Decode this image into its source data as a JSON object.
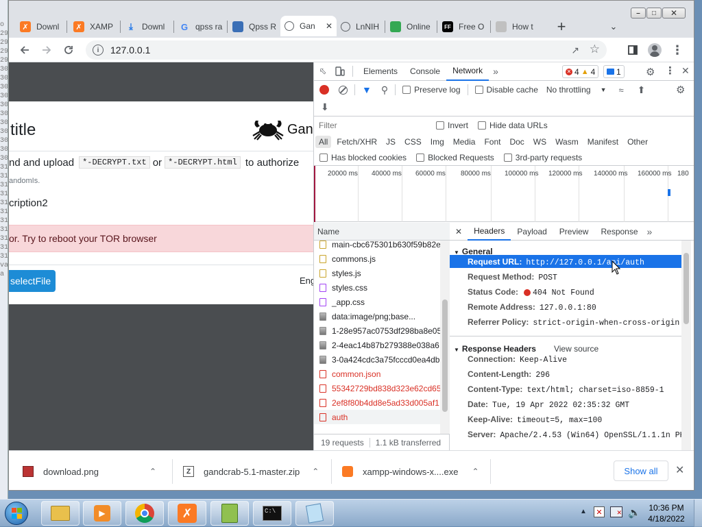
{
  "left_strip_chars": [
    "o",
    "29",
    "29",
    "29",
    "29",
    "30",
    "30",
    "30",
    "30",
    "30",
    "30",
    "30",
    "30",
    "30",
    "30",
    "30",
    "31",
    "31",
    "31",
    "31",
    "31",
    "31",
    "31",
    "31",
    "31",
    "31",
    "31",
    "va",
    "a"
  ],
  "tabs": [
    {
      "title": "Downl",
      "icon": "xampp-icon",
      "color": "#fb7a24"
    },
    {
      "title": "XAMP",
      "icon": "xampp-icon",
      "color": "#fb7a24"
    },
    {
      "title": "Downl",
      "icon": "download-icon",
      "color": "#1a73e8"
    },
    {
      "title": "qpss ra",
      "icon": "google-icon",
      "color": "#4285f4"
    },
    {
      "title": "Qpss R",
      "icon": "qpss-icon",
      "color": "#3b6fb6"
    },
    {
      "title": "Gan",
      "icon": "globe-icon",
      "color": "#5f6368"
    },
    {
      "title": "LnNIH",
      "icon": "globe-icon",
      "color": "#5f6368"
    },
    {
      "title": "Online",
      "icon": "online-icon",
      "color": "#34a853"
    },
    {
      "title": "Free O",
      "icon": "ff-icon",
      "color": "#000000"
    },
    {
      "title": "How t",
      "icon": "face-icon",
      "color": "#c0c0c0"
    }
  ],
  "address": "127.0.0.1",
  "page": {
    "title": "title",
    "brand": "Gan",
    "upload_text_pre": "nd and upload",
    "code1": "*-DECRYPT.txt",
    "or": "or",
    "code2": "*-DECRYPT.html",
    "upload_text_post": "to authorize",
    "random_ids": "andomIs.",
    "description": "cription2",
    "error": "or. Try to reboot your TOR browser",
    "select_button": "selectFile",
    "lang": "Eng"
  },
  "devtools": {
    "tabs": [
      "Elements",
      "Console",
      "Network"
    ],
    "active_tab": "Network",
    "errors": "4",
    "warnings": "4",
    "messages": "1",
    "preserve_log": "Preserve log",
    "disable_cache": "Disable cache",
    "throttling": "No throttling",
    "filter_placeholder": "Filter",
    "invert": "Invert",
    "hide_data_urls": "Hide data URLs",
    "types": [
      "All",
      "Fetch/XHR",
      "JS",
      "CSS",
      "Img",
      "Media",
      "Font",
      "Doc",
      "WS",
      "Wasm",
      "Manifest",
      "Other"
    ],
    "blocked_cookies": "Has blocked cookies",
    "blocked_requests": "Blocked Requests",
    "third_party": "3rd-party requests",
    "timeline_ticks": [
      "20000 ms",
      "40000 ms",
      "60000 ms",
      "80000 ms",
      "100000 ms",
      "120000 ms",
      "140000 ms",
      "160000 ms",
      "180"
    ],
    "name_header": "Name",
    "requests": [
      {
        "name": "main-cbc675301b630f59b82e",
        "kind": "js",
        "color": "#202124"
      },
      {
        "name": "commons.js",
        "kind": "js",
        "color": "#202124"
      },
      {
        "name": "styles.js",
        "kind": "js",
        "color": "#202124"
      },
      {
        "name": "styles.css",
        "kind": "css",
        "color": "#202124"
      },
      {
        "name": "_app.css",
        "kind": "css",
        "color": "#202124"
      },
      {
        "name": "data:image/png;base...",
        "kind": "img",
        "color": "#202124"
      },
      {
        "name": "1-28e957ac0753df298ba8e05",
        "kind": "img",
        "color": "#202124"
      },
      {
        "name": "2-4eac14b87b279388e038a6",
        "kind": "img",
        "color": "#202124"
      },
      {
        "name": "3-0a424cdc3a75fcccd0ea4db",
        "kind": "img",
        "color": "#202124"
      },
      {
        "name": "common.json",
        "kind": "err",
        "color": "#d93025"
      },
      {
        "name": "55342729bd838d323e62cd65",
        "kind": "err",
        "color": "#d93025"
      },
      {
        "name": "2ef8f80b4dd8e5ad33d005af1",
        "kind": "err",
        "color": "#d93025"
      },
      {
        "name": "auth",
        "kind": "err",
        "color": "#d93025"
      }
    ],
    "summary_requests": "19 requests",
    "summary_transferred": "1.1 kB transferred",
    "detail_tabs": [
      "Headers",
      "Payload",
      "Preview",
      "Response"
    ],
    "general_label": "General",
    "general": [
      {
        "key": "Request URL:",
        "value": "http://127.0.0.1/api/auth"
      },
      {
        "key": "Request Method:",
        "value": "POST"
      },
      {
        "key": "Status Code:",
        "value": "404 Not Found"
      },
      {
        "key": "Remote Address:",
        "value": "127.0.0.1:80"
      },
      {
        "key": "Referrer Policy:",
        "value": "strict-origin-when-cross-origin"
      }
    ],
    "response_headers_label": "Response Headers",
    "view_source": "View source",
    "response_headers": [
      {
        "key": "Connection:",
        "value": "Keep-Alive"
      },
      {
        "key": "Content-Length:",
        "value": "296"
      },
      {
        "key": "Content-Type:",
        "value": "text/html; charset=iso-8859-1"
      },
      {
        "key": "Date:",
        "value": "Tue, 19 Apr 2022 02:35:32 GMT"
      },
      {
        "key": "Keep-Alive:",
        "value": "timeout=5, max=100"
      },
      {
        "key": "Server:",
        "value": "Apache/2.4.53 (Win64) OpenSSL/1.1.1n PH"
      }
    ]
  },
  "downloads": [
    {
      "name": "download.png"
    },
    {
      "name": "gandcrab-5.1-master.zip"
    },
    {
      "name": "xampp-windows-x....exe"
    }
  ],
  "show_all": "Show all",
  "clock": {
    "time": "10:36 PM",
    "date": "4/18/2022"
  },
  "colors": {
    "devtools_accent": "#1a73e8",
    "error_red": "#d93025",
    "highlight": "#1a73e8",
    "alert_bg": "#f8d7da",
    "button_blue": "#1d8cd6"
  }
}
